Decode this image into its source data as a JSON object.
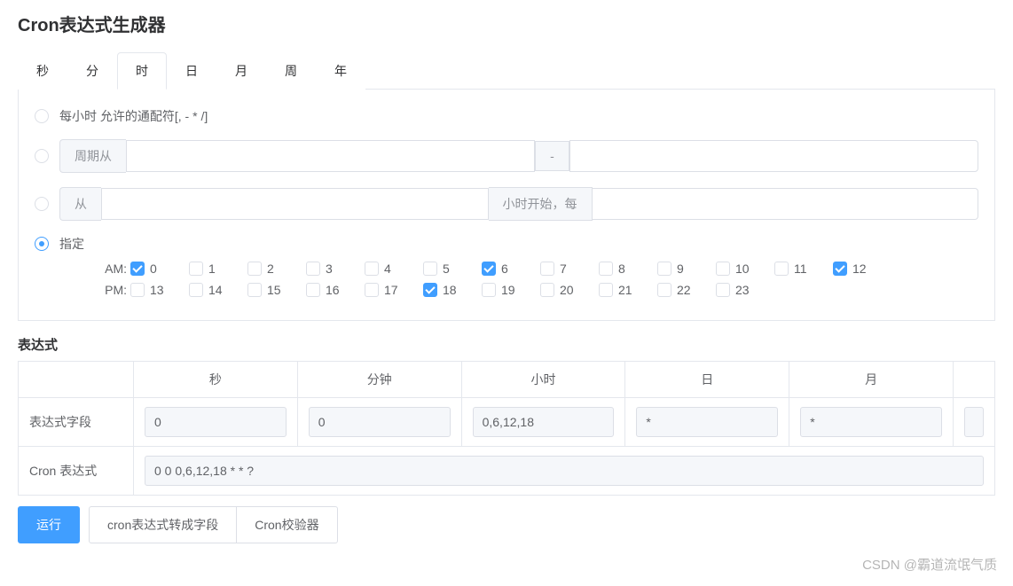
{
  "title": "Cron表达式生成器",
  "tabs": [
    "秒",
    "分",
    "时",
    "日",
    "月",
    "周",
    "年"
  ],
  "activeTab": 2,
  "hourPane": {
    "opt1": "每小时 允许的通配符[, - * /]",
    "opt2_prefix": "周期从",
    "opt2_sep": "-",
    "opt3_prefix": "从",
    "opt3_suffix": "小时开始，每",
    "opt4": "指定",
    "amLabel": "AM:",
    "pmLabel": "PM:",
    "am": [
      "0",
      "1",
      "2",
      "3",
      "4",
      "5",
      "6",
      "7",
      "8",
      "9",
      "10",
      "11",
      "12"
    ],
    "pm": [
      "13",
      "14",
      "15",
      "16",
      "17",
      "18",
      "19",
      "20",
      "21",
      "22",
      "23"
    ],
    "checked": [
      "0",
      "6",
      "12",
      "18"
    ]
  },
  "expr": {
    "heading": "表达式",
    "cols": [
      "",
      "秒",
      "分钟",
      "小时",
      "日",
      "月",
      ""
    ],
    "rowLabel": "表达式字段",
    "vals": [
      "0",
      "0",
      "0,6,12,18",
      "*",
      "*",
      "?"
    ],
    "cronLabel": "Cron 表达式",
    "cronValue": "0 0 0,6,12,18 * * ?"
  },
  "buttons": {
    "run": "运行",
    "toField": "cron表达式转成字段",
    "validator": "Cron校验器"
  },
  "watermark": "CSDN @霸道流氓气质"
}
